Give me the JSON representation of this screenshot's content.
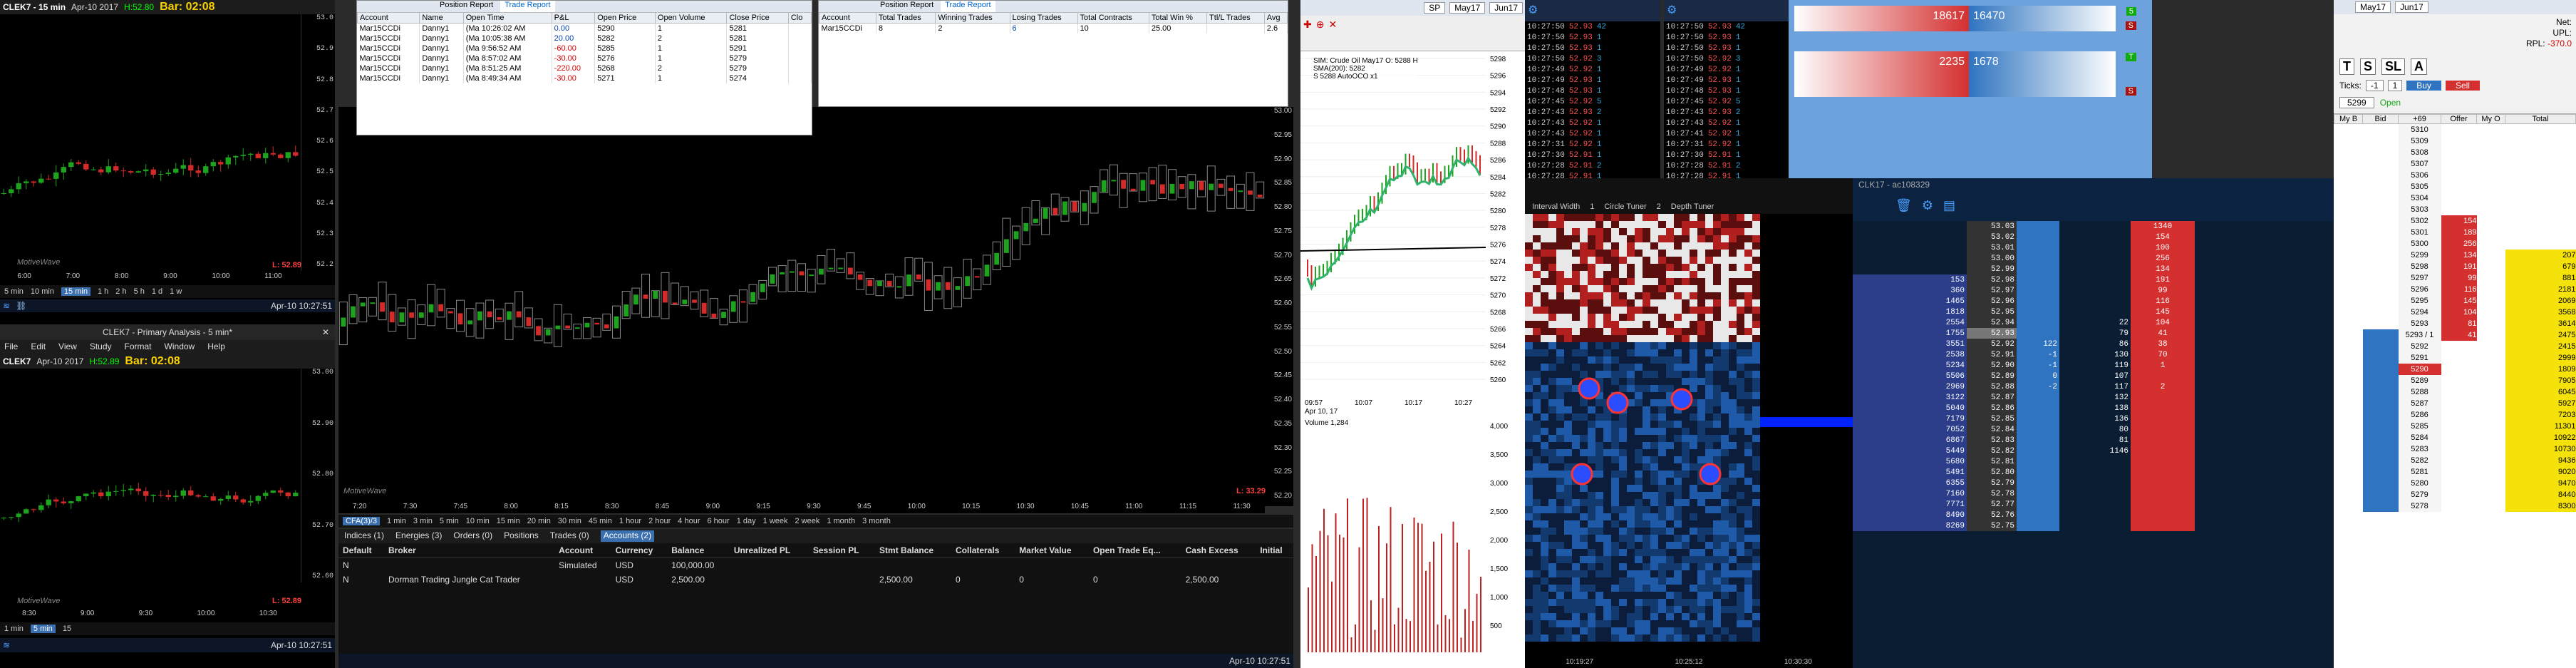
{
  "chart_15min": {
    "symbol": "CLEK7 - 15 min",
    "date": "Apr-10 2017",
    "h_label": "H:52.80",
    "bar_time": "Bar: 02:08",
    "pl": "L: 52.89",
    "watermark": "MotiveWave",
    "x_ticks": [
      "6:00",
      "7:00",
      "8:00",
      "9:00",
      "10:00",
      "11:00"
    ],
    "y_ticks": [
      "53.0",
      "52.9",
      "52.8",
      "52.7",
      "52.6",
      "52.5",
      "52.4",
      "52.3",
      "52.2"
    ],
    "timeframes": [
      "5 min",
      "10 min",
      "15 min",
      "1 h",
      "2 h",
      "5 h",
      "1 d",
      "1 w"
    ],
    "status_time": "Apr-10 10:27:51"
  },
  "primary_analysis": {
    "title": "CLEK7 - Primary Analysis - 5 min*",
    "menu": [
      "File",
      "Edit",
      "View",
      "Study",
      "Format",
      "Window",
      "Help"
    ],
    "symbol": "CLEK7",
    "date": "Apr-10 2017",
    "h_label": "H:52.89",
    "bar_time": "Bar: 02:08",
    "pl": "L: 52.89",
    "watermark": "MotiveWave",
    "x_ticks": [
      "8:30",
      "9:00",
      "9:30",
      "10:00",
      "10:30"
    ],
    "y_ticks": [
      "53.00",
      "52.90",
      "52.80",
      "52.70",
      "52.60"
    ],
    "timeframes": [
      "1 min",
      "5 min",
      "15"
    ],
    "status_time": "Apr-10 10:27:51"
  },
  "position_report": {
    "tabs": [
      "Position Report",
      "Trade Report"
    ],
    "columns": [
      "Account",
      "Name",
      "Open Time",
      "P&L",
      "Open Price",
      "Open Volume",
      "Close Price",
      "Clo"
    ],
    "rows": [
      [
        "Mar15CCDi",
        "Danny1",
        "(Ma 10:26:02 AM",
        "0.00",
        "5290",
        "1",
        "5281",
        ""
      ],
      [
        "Mar15CCDi",
        "Danny1",
        "(Ma 10:05:38 AM",
        "20.00",
        "5282",
        "2",
        "5281",
        ""
      ],
      [
        "Mar15CCDi",
        "Danny1",
        "(Ma 9:56:52 AM",
        "-60.00",
        "5285",
        "1",
        "5291",
        ""
      ],
      [
        "Mar15CCDi",
        "Danny1",
        "(Ma 8:57:02 AM",
        "-30.00",
        "5276",
        "1",
        "5279",
        ""
      ],
      [
        "Mar15CCDi",
        "Danny1",
        "(Ma 8:51:25 AM",
        "-220.00",
        "5268",
        "2",
        "5279",
        ""
      ],
      [
        "Mar15CCDi",
        "Danny1",
        "(Ma 8:49:34 AM",
        "-30.00",
        "5271",
        "1",
        "5274",
        ""
      ]
    ]
  },
  "trade_report": {
    "tabs": [
      "Position Report",
      "Trade Report"
    ],
    "columns": [
      "Account",
      "Total Trades",
      "Winning Trades",
      "Losing Trades",
      "Total Contracts",
      "Total Win %",
      "Ttl/L Trades",
      "Avg"
    ],
    "rows": [
      [
        "Mar15CCDi",
        "8",
        "2",
        "6",
        "10",
        "25.00",
        "",
        "2.6"
      ]
    ]
  },
  "main_chart": {
    "y_ticks": [
      "53.00",
      "52.95",
      "52.90",
      "52.85",
      "52.80",
      "52.75",
      "52.70",
      "52.65",
      "52.60",
      "52.55",
      "52.50",
      "52.45",
      "52.40",
      "52.35",
      "52.30",
      "52.25",
      "52.20"
    ],
    "x_ticks": [
      "7:20",
      "7:30",
      "7:45",
      "8:00",
      "8:15",
      "8:30",
      "8:45",
      "9:00",
      "9:15",
      "9:30",
      "9:45",
      "10:00",
      "10:15",
      "10:30",
      "10:45",
      "11:00",
      "11:15",
      "11:30"
    ],
    "pl": "L: 33.29",
    "watermark": "MotiveWave",
    "timeframes": [
      "1 min",
      "3 min",
      "5 min",
      "10 min",
      "15 min",
      "20 min",
      "30 min",
      "45 min",
      "1 hour",
      "2 hour",
      "4 hour",
      "6 hour",
      "1 day",
      "1 week",
      "2 week",
      "1 month",
      "3 month"
    ],
    "period_tab": "CFA(3)/3"
  },
  "accounts_panel": {
    "tabs": [
      "Indices (1)",
      "Energies (3)",
      "Orders (0)",
      "Positions",
      "Trades (0)",
      "Accounts (2)"
    ],
    "columns": [
      "Default",
      "Broker",
      "Account",
      "Currency",
      "Balance",
      "Unrealized PL",
      "Session PL",
      "Stmt Balance",
      "Collaterals",
      "Market Value",
      "Open Trade Eq...",
      "Cash Excess",
      "Initial"
    ],
    "rows": [
      [
        "N",
        "",
        "Simulated",
        "USD",
        "100,000.00",
        "",
        "",
        "",
        "",
        "",
        "",
        "",
        ""
      ],
      [
        "N",
        "Dorman Trading Jungle Cat Trader",
        "",
        "USD",
        "2,500.00",
        "",
        "",
        "2,500.00",
        "0",
        "0",
        "0",
        "2,500.00",
        ""
      ]
    ],
    "status_time": "Apr-10 10:27:51"
  },
  "mini_chart": {
    "tabs": [
      "SP",
      "May17",
      "Jun17"
    ],
    "legend": [
      "SIM: Crude Oil May17 O: 5288 H",
      "SMA(200): 5282",
      "S 5288 AutoOCO x1"
    ],
    "y_ticks": [
      "5298",
      "5296",
      "5294",
      "5292",
      "5290",
      "5288",
      "5286",
      "5284",
      "5282",
      "5280",
      "5278",
      "5276",
      "5274",
      "5272",
      "5270",
      "5268",
      "5266",
      "5264",
      "5262",
      "5260"
    ],
    "x_ticks": [
      "09:57",
      "10:07",
      "10:17",
      "10:27"
    ],
    "date": "Apr 10, 17",
    "volume_label": "Volume 1,284",
    "vol_ticks": [
      "4,000",
      "3,500",
      "3,000",
      "2,500",
      "2,000",
      "1,500",
      "1,000",
      "500"
    ]
  },
  "time_sales_1": {
    "rows": [
      [
        "10:27:50",
        "52.93",
        "42"
      ],
      [
        "10:27:50",
        "52.93",
        "1"
      ],
      [
        "10:27:50",
        "52.93",
        "1"
      ],
      [
        "10:27:50",
        "52.92",
        "3"
      ],
      [
        "10:27:49",
        "52.92",
        "1"
      ],
      [
        "10:27:49",
        "52.93",
        "1"
      ],
      [
        "10:27:48",
        "52.93",
        "1"
      ],
      [
        "10:27:45",
        "52.92",
        "5"
      ],
      [
        "10:27:43",
        "52.93",
        "2"
      ],
      [
        "10:27:43",
        "52.92",
        "1"
      ],
      [
        "10:27:43",
        "52.92",
        "1"
      ],
      [
        "10:27:31",
        "52.92",
        "1"
      ],
      [
        "10:27:30",
        "52.91",
        "1"
      ],
      [
        "10:27:28",
        "52.91",
        "2"
      ],
      [
        "10:27:28",
        "52.91",
        "1"
      ]
    ]
  },
  "time_sales_2": {
    "rows": [
      [
        "10:27:50",
        "52.93",
        "42"
      ],
      [
        "10:27:50",
        "52.93",
        "1"
      ],
      [
        "10:27:50",
        "52.93",
        "1"
      ],
      [
        "10:27:50",
        "52.92",
        "3"
      ],
      [
        "10:27:49",
        "52.92",
        "1"
      ],
      [
        "10:27:49",
        "52.93",
        "1"
      ],
      [
        "10:27:48",
        "52.93",
        "1"
      ],
      [
        "10:27:45",
        "52.92",
        "5"
      ],
      [
        "10:27:43",
        "52.93",
        "2"
      ],
      [
        "10:27:43",
        "52.92",
        "1"
      ],
      [
        "10:27:41",
        "52.92",
        "1"
      ],
      [
        "10:27:31",
        "52.92",
        "1"
      ],
      [
        "10:27:30",
        "52.91",
        "1"
      ],
      [
        "10:27:28",
        "52.91",
        "2"
      ],
      [
        "10:27:28",
        "52.91",
        "1"
      ]
    ]
  },
  "bid_ask_bars": [
    {
      "bid": "18617",
      "ask": "16470",
      "b1": "5",
      "b2": "S"
    },
    {
      "bid": "2235",
      "ask": "1678",
      "b1": "T",
      "b2": "S"
    }
  ],
  "heatmap": {
    "controls": [
      "Interval Width",
      "1",
      "Circle Tuner",
      "2",
      "Depth Tuner"
    ],
    "x_ticks": [
      "10:19:27",
      "10:25:12",
      "10:30:30"
    ]
  },
  "dom_ladder": {
    "title": "CLK17 - ac108329",
    "rows": [
      {
        "bid_vol": "",
        "price": "53.03",
        "bv": "",
        "av": "",
        "ask": "1340"
      },
      {
        "bid_vol": "",
        "price": "53.02",
        "bv": "",
        "av": "",
        "ask": "154"
      },
      {
        "bid_vol": "",
        "price": "53.01",
        "bv": "",
        "av": "",
        "ask": "100"
      },
      {
        "bid_vol": "",
        "price": "53.00",
        "bv": "",
        "av": "",
        "ask": "256"
      },
      {
        "bid_vol": "",
        "price": "52.99",
        "bv": "",
        "av": "",
        "ask": "134"
      },
      {
        "bid_vol": "153",
        "price": "52.98",
        "bv": "",
        "av": "",
        "ask": "191"
      },
      {
        "bid_vol": "360",
        "price": "52.97",
        "bv": "",
        "av": "",
        "ask": "99"
      },
      {
        "bid_vol": "1465",
        "price": "52.96",
        "bv": "",
        "av": "",
        "ask": "116"
      },
      {
        "bid_vol": "1818",
        "price": "52.95",
        "bv": "",
        "av": "",
        "ask": "145"
      },
      {
        "bid_vol": "2554",
        "price": "52.94",
        "bv": "",
        "av": "22",
        "ask": "104"
      },
      {
        "bid_vol": "1755",
        "price": "52.93",
        "bv": "",
        "av": "79",
        "ask": "41"
      },
      {
        "bid_vol": "3551",
        "price": "52.92",
        "bv": "122",
        "av": "86",
        "ask": "38"
      },
      {
        "bid_vol": "2538",
        "price": "52.91",
        "bv": "-1",
        "av": "130",
        "ask": "70"
      },
      {
        "bid_vol": "5234",
        "price": "52.90",
        "bv": "-1",
        "av": "119",
        "ask": "1"
      },
      {
        "bid_vol": "5506",
        "price": "52.89",
        "bv": "0",
        "av": "107",
        "ask": ""
      },
      {
        "bid_vol": "2969",
        "price": "52.88",
        "bv": "-2",
        "av": "117",
        "ask": "2"
      },
      {
        "bid_vol": "3122",
        "price": "52.87",
        "bv": "",
        "av": "132",
        "ask": ""
      },
      {
        "bid_vol": "5040",
        "price": "52.86",
        "bv": "",
        "av": "138",
        "ask": ""
      },
      {
        "bid_vol": "7179",
        "price": "52.85",
        "bv": "",
        "av": "136",
        "ask": ""
      },
      {
        "bid_vol": "7052",
        "price": "52.84",
        "bv": "",
        "av": "80",
        "ask": ""
      },
      {
        "bid_vol": "6867",
        "price": "52.83",
        "bv": "",
        "av": "81",
        "ask": ""
      },
      {
        "bid_vol": "5449",
        "price": "52.82",
        "bv": "",
        "av": "1146",
        "ask": ""
      },
      {
        "bid_vol": "5680",
        "price": "52.81",
        "bv": "",
        "av": "",
        "ask": ""
      },
      {
        "bid_vol": "5491",
        "price": "52.80",
        "bv": "",
        "av": "",
        "ask": ""
      },
      {
        "bid_vol": "6355",
        "price": "52.79",
        "bv": "",
        "av": "",
        "ask": ""
      },
      {
        "bid_vol": "7160",
        "price": "52.78",
        "bv": "",
        "av": "",
        "ask": ""
      },
      {
        "bid_vol": "7771",
        "price": "52.77",
        "bv": "",
        "av": "",
        "ask": ""
      },
      {
        "bid_vol": "8490",
        "price": "52.76",
        "bv": "",
        "av": "",
        "ask": ""
      },
      {
        "bid_vol": "8269",
        "price": "52.75",
        "bv": "",
        "av": "",
        "ask": ""
      }
    ]
  },
  "order_entry": {
    "tabs": [
      "May17",
      "Jun17"
    ],
    "fields": {
      "net": "Net:",
      "upl": "UPL:",
      "rpl": "RPL:",
      "rpl_val": "-370.0",
      "ticks_label": "Ticks:",
      "ticks_val": "-1",
      "qty": "1",
      "price": "5299"
    },
    "buttons": [
      "T",
      "S",
      "SL",
      "A"
    ],
    "buy": "Buy",
    "sell": "Sell",
    "opn": "Open",
    "columns": [
      "My B",
      "Bid",
      "+69",
      "Offer",
      "My O",
      "Total"
    ],
    "rows": [
      {
        "price": "5310",
        "offer": "",
        "total": ""
      },
      {
        "price": "5309",
        "offer": "",
        "total": ""
      },
      {
        "price": "5308",
        "offer": "",
        "total": ""
      },
      {
        "price": "5307",
        "offer": "",
        "total": ""
      },
      {
        "price": "5306",
        "offer": "",
        "total": ""
      },
      {
        "price": "5305",
        "offer": "",
        "total": ""
      },
      {
        "price": "5304",
        "offer": "",
        "total": ""
      },
      {
        "price": "5303",
        "offer": "",
        "total": ""
      },
      {
        "price": "5302",
        "offer": "154",
        "total": ""
      },
      {
        "price": "5301",
        "offer": "189",
        "total": ""
      },
      {
        "price": "5300",
        "offer": "256",
        "total": ""
      },
      {
        "price": "5299",
        "offer": "134",
        "total": "207"
      },
      {
        "price": "5298",
        "offer": "191",
        "total": "679"
      },
      {
        "price": "5297",
        "offer": "99",
        "total": "881"
      },
      {
        "price": "5296",
        "offer": "116",
        "total": "2181"
      },
      {
        "price": "5295",
        "offer": "145",
        "total": "2069"
      },
      {
        "price": "5294",
        "offer": "104",
        "total": "3568"
      },
      {
        "price": "5293",
        "offer": "81",
        "total": "3614"
      },
      {
        "price": "5293 / 1",
        "offer": "41",
        "total": "2475"
      },
      {
        "price": "5292",
        "offer": "",
        "total": "2415"
      },
      {
        "price": "5291",
        "offer": "",
        "total": "2999"
      },
      {
        "price": "5290",
        "offer": "",
        "total": "1809"
      },
      {
        "price": "5289",
        "offer": "",
        "total": "7905"
      },
      {
        "price": "5288",
        "offer": "",
        "total": "6045"
      },
      {
        "price": "5287",
        "offer": "",
        "total": "5927"
      },
      {
        "price": "5286",
        "offer": "",
        "total": "7203"
      },
      {
        "price": "5285",
        "offer": "",
        "total": "11301"
      },
      {
        "price": "5284",
        "offer": "",
        "total": "10922"
      },
      {
        "price": "5283",
        "offer": "",
        "total": "10730"
      },
      {
        "price": "5282",
        "offer": "",
        "total": "9436"
      },
      {
        "price": "5281",
        "offer": "",
        "total": "9020"
      },
      {
        "price": "5280",
        "offer": "",
        "total": "9470"
      },
      {
        "price": "5279",
        "offer": "",
        "total": "8440"
      },
      {
        "price": "5278",
        "offer": "",
        "total": "8300"
      }
    ]
  },
  "colors": {
    "bull": "#1ea31e",
    "bear": "#d42a2a",
    "bid_blue": "#2f74c0",
    "ask_red": "#d43030",
    "accent": "#3a6fb0"
  }
}
